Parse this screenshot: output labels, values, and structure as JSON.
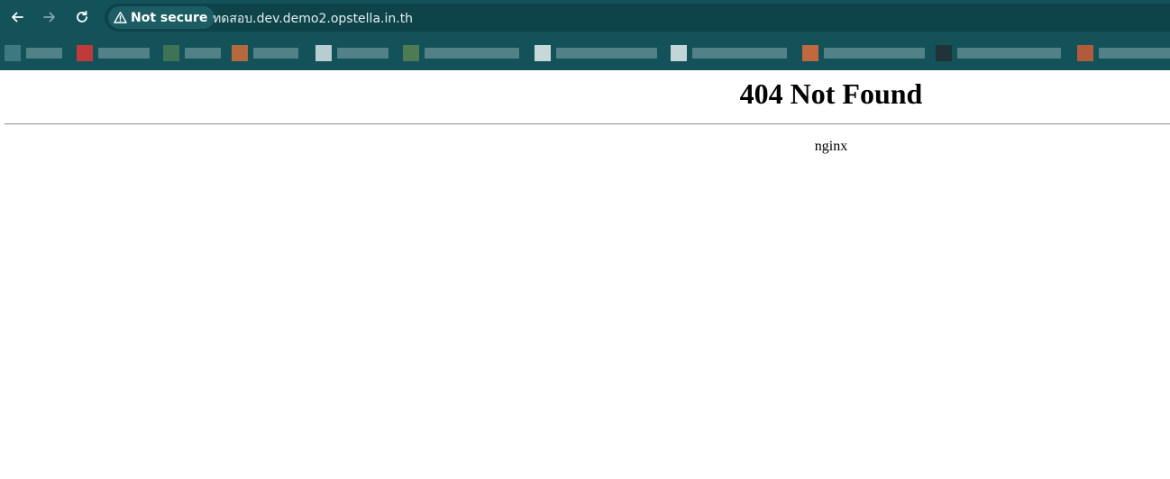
{
  "toolbar": {
    "back_icon": "arrow-left-icon",
    "forward_icon": "arrow-right-icon",
    "reload_icon": "reload-icon"
  },
  "omnibox": {
    "security_label": "Not secure",
    "security_icon": "warning-triangle-icon",
    "url": "ทดสอบ.dev.demo2.opstella.in.th"
  },
  "bookmarks": {
    "count": 9,
    "note_blurred": true
  },
  "page": {
    "heading": "404 Not Found",
    "server": "nginx"
  },
  "colors": {
    "chrome": "#135259",
    "omnibox": "#0d4349"
  }
}
